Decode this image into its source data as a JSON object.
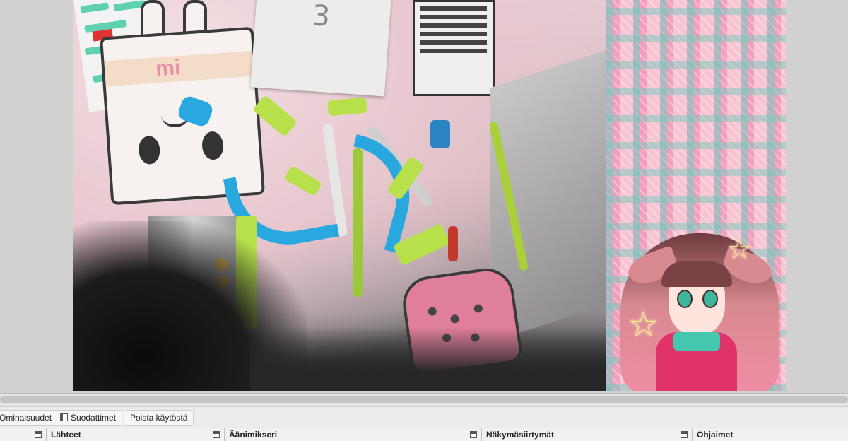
{
  "toolbar": {
    "properties_label": "Ominaisuudet",
    "filters_label": "Suodattimet",
    "disable_label": "Poista käytöstä"
  },
  "docks": [
    {
      "title": ""
    },
    {
      "title": "Lähteet"
    },
    {
      "title": "Äänimikseri"
    },
    {
      "title": "Näkymäsiirtymät"
    },
    {
      "title": "Ohjaimet"
    }
  ],
  "preview": {
    "paper_number": "3",
    "sticker_text": "mi"
  },
  "colors": {
    "background": "#d4d4d4",
    "toolbar_bg": "#ececec",
    "dock_header_bg": "#f1f1f1",
    "lego_lime": "#b7e04a",
    "lego_cyan": "#29a8e0"
  },
  "icons": {
    "filters": "filter-icon",
    "dock_float": "undock-icon"
  }
}
